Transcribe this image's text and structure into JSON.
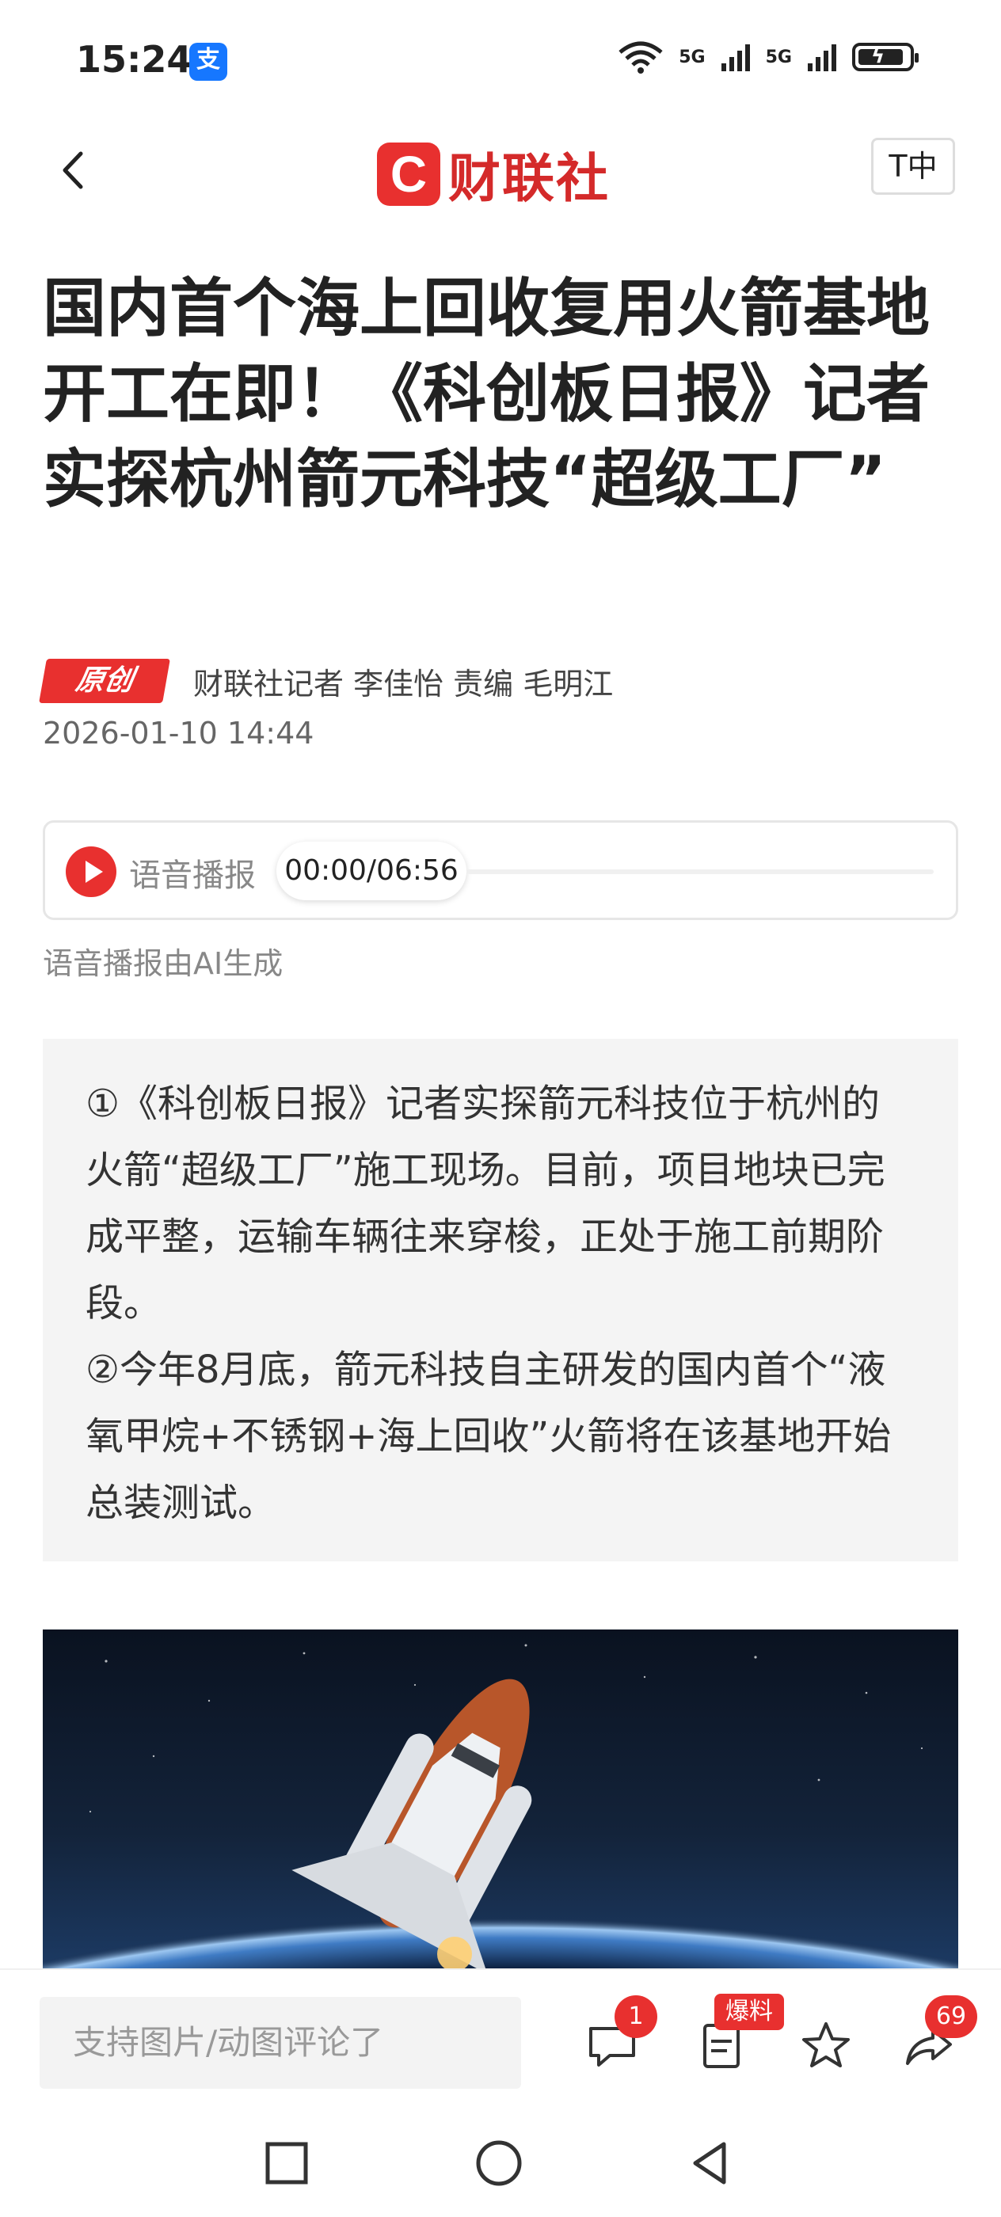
{
  "status_bar": {
    "time": "15:24",
    "alipay_glyph": "支",
    "network_1": "5G",
    "network_2": "5G",
    "battery_level": 0.9
  },
  "header": {
    "logo_mark": "C",
    "logo_text": "财联社",
    "font_size_button": "T中"
  },
  "article": {
    "title": "国内首个海上回收复用火箭基地开工在即！《科创板日报》记者实探杭州箭元科技“超级工厂”",
    "badge": "原创",
    "author_line": "财联社记者 李佳怡  责编 毛明江",
    "publish_time": "2026-01-10 14:44"
  },
  "audio": {
    "label": "语音播报",
    "time": "00:00/06:56",
    "progress": 0,
    "ai_note": "语音播报由AI生成"
  },
  "summary": {
    "point_1": "①《科创板日报》记者实探箭元科技位于杭州的火箭“超级工厂”施工现场。目前，项目地块已完成平整，运输车辆往来穿梭，正处于施工前期阶段。",
    "point_2": "②今年8月底，箭元科技自主研发的国内首个“液氧甲烷+不锈钢+海上回收”火箭将在该基地开始总装测试。"
  },
  "bottom_bar": {
    "comment_placeholder": "支持图片/动图评论了",
    "comment_count": "1",
    "baoliao_label": "爆料",
    "share_count": "69"
  },
  "colors": {
    "brand_red": "#e8302f",
    "summary_bg": "#f4f4f4"
  },
  "icons": [
    "back-icon",
    "wifi-icon",
    "signal-icon",
    "battery-icon",
    "play-icon",
    "comment-icon",
    "news-tip-icon",
    "star-icon",
    "share-icon",
    "square-icon",
    "circle-icon",
    "triangle-back-icon"
  ]
}
